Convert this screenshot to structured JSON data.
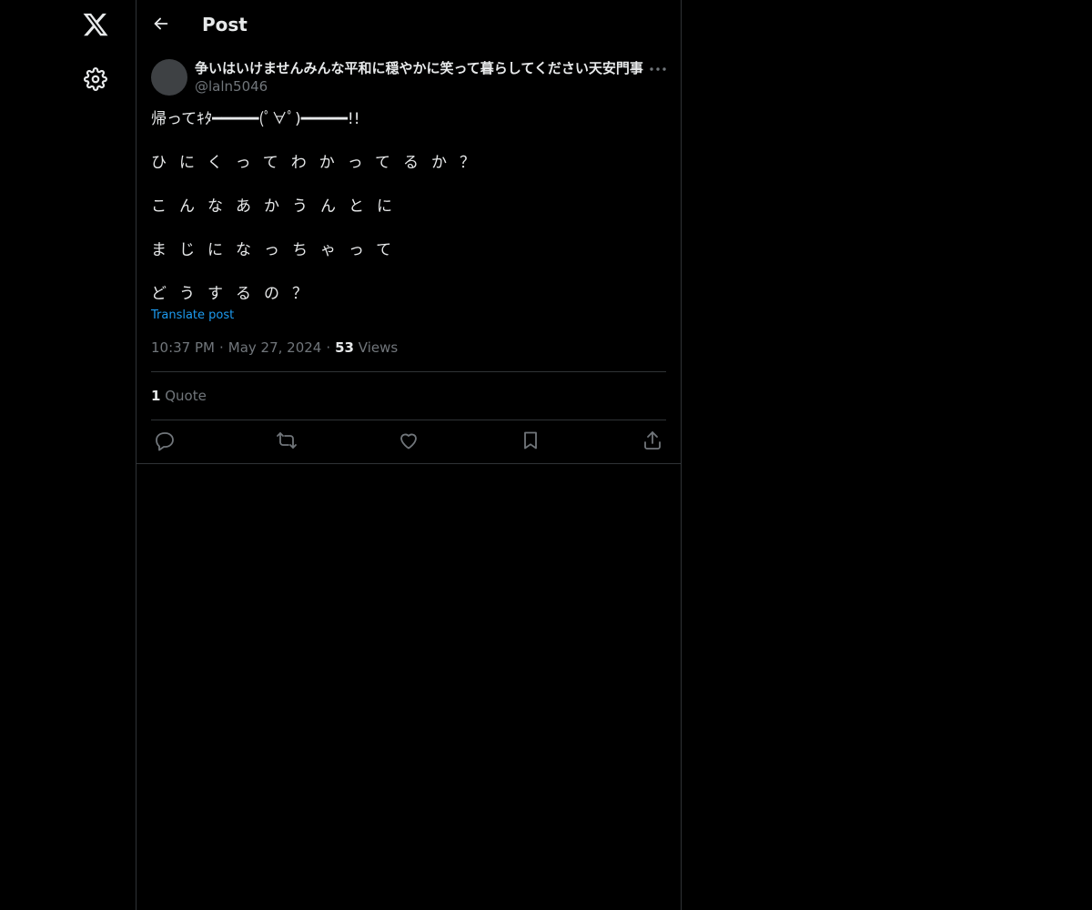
{
  "header": {
    "title": "Post"
  },
  "post": {
    "display_name": "争いはいけませんみんな平和に穏やかに笑って暮らしてください天安門事",
    "handle": "@laln5046",
    "lines": [
      "帰ってｷﾀ━━━━━(ﾟ∀ﾟ)━━━━━!!",
      "ひにくってわかってるか？",
      "こんなあかうんとに",
      "まじになっちゃって",
      "どうするの？"
    ],
    "translate_label": "Translate post",
    "time": "10:37 PM",
    "date": "May 27, 2024",
    "views_count": "53",
    "views_label": "Views",
    "quotes_count": "1",
    "quotes_label": "Quote"
  },
  "icons": {
    "logo": "x-logo-icon",
    "settings": "gear-icon",
    "back": "arrow-left-icon",
    "more": "more-horizontal-icon",
    "reply": "reply-icon",
    "repost": "repost-icon",
    "like": "heart-icon",
    "bookmark": "bookmark-icon",
    "share": "share-icon"
  },
  "colors": {
    "background": "#000000",
    "text": "#e7e9ea",
    "secondary_text": "#71767b",
    "link": "#1d9bf0",
    "border": "#2f3336"
  }
}
